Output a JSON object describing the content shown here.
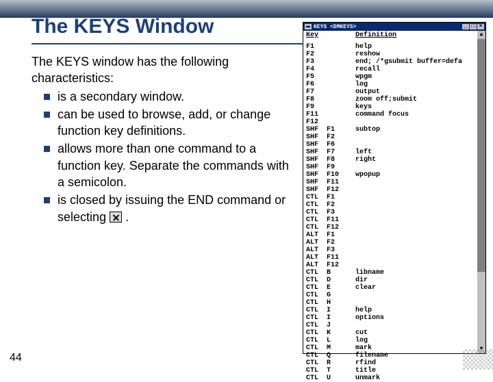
{
  "slide": {
    "title": "The KEYS Window",
    "page_number": "44",
    "intro": "The KEYS window has the following characteristics:",
    "bullets": [
      "is a secondary window.",
      "can be used to browse, add, or change function key definitions.",
      "allows more than one command to a function key. Separate the commands with a semicolon.",
      "is closed by issuing the END command or selecting "
    ],
    "bullet4_suffix": " ."
  },
  "keys_window": {
    "title": "KEYS <DMKEYS>",
    "col_key": "Key",
    "col_def": "Definition",
    "rows": [
      {
        "k1": "F1",
        "k2": "",
        "def": "help"
      },
      {
        "k1": "F2",
        "k2": "",
        "def": "reshow"
      },
      {
        "k1": "F3",
        "k2": "",
        "def": "end; /*gsubmit buffer=defa"
      },
      {
        "k1": "F4",
        "k2": "",
        "def": "recall"
      },
      {
        "k1": "F5",
        "k2": "",
        "def": "wpgm"
      },
      {
        "k1": "F6",
        "k2": "",
        "def": "log"
      },
      {
        "k1": "F7",
        "k2": "",
        "def": "output"
      },
      {
        "k1": "F8",
        "k2": "",
        "def": "zoom off;submit"
      },
      {
        "k1": "F9",
        "k2": "",
        "def": "keys"
      },
      {
        "k1": "F11",
        "k2": "",
        "def": "command focus"
      },
      {
        "k1": "F12",
        "k2": "",
        "def": ""
      },
      {
        "k1": "SHF",
        "k2": "F1",
        "def": "subtop"
      },
      {
        "k1": "SHF",
        "k2": "F2",
        "def": ""
      },
      {
        "k1": "SHF",
        "k2": "F6",
        "def": ""
      },
      {
        "k1": "SHF",
        "k2": "F7",
        "def": "left"
      },
      {
        "k1": "SHF",
        "k2": "F8",
        "def": "right"
      },
      {
        "k1": "SHF",
        "k2": "F9",
        "def": ""
      },
      {
        "k1": "SHF",
        "k2": "F10",
        "def": "wpopup"
      },
      {
        "k1": "SHF",
        "k2": "F11",
        "def": ""
      },
      {
        "k1": "SHF",
        "k2": "F12",
        "def": ""
      },
      {
        "k1": "CTL",
        "k2": "F1",
        "def": ""
      },
      {
        "k1": "CTL",
        "k2": "F2",
        "def": ""
      },
      {
        "k1": "CTL",
        "k2": "F3",
        "def": ""
      },
      {
        "k1": "CTL",
        "k2": "F11",
        "def": ""
      },
      {
        "k1": "CTL",
        "k2": "F12",
        "def": ""
      },
      {
        "k1": "ALT",
        "k2": "F1",
        "def": ""
      },
      {
        "k1": "ALT",
        "k2": "F2",
        "def": ""
      },
      {
        "k1": "ALT",
        "k2": "F3",
        "def": ""
      },
      {
        "k1": "ALT",
        "k2": "F11",
        "def": ""
      },
      {
        "k1": "ALT",
        "k2": "F12",
        "def": ""
      },
      {
        "k1": "CTL",
        "k2": "B",
        "def": "libname"
      },
      {
        "k1": "CTL",
        "k2": "D",
        "def": "dir"
      },
      {
        "k1": "CTL",
        "k2": "E",
        "def": "clear"
      },
      {
        "k1": "CTL",
        "k2": "G",
        "def": ""
      },
      {
        "k1": "CTL",
        "k2": "H",
        "def": ""
      },
      {
        "k1": "CTL",
        "k2": "I",
        "def": "help"
      },
      {
        "k1": "CTL",
        "k2": "I",
        "def": "options"
      },
      {
        "k1": "CTL",
        "k2": "J",
        "def": ""
      },
      {
        "k1": "CTL",
        "k2": "K",
        "def": "cut"
      },
      {
        "k1": "CTL",
        "k2": "L",
        "def": "log"
      },
      {
        "k1": "CTL",
        "k2": "M",
        "def": "mark"
      },
      {
        "k1": "CTL",
        "k2": "Q",
        "def": "filename"
      },
      {
        "k1": "CTL",
        "k2": "R",
        "def": "rfind"
      },
      {
        "k1": "CTL",
        "k2": "T",
        "def": "title"
      },
      {
        "k1": "CTL",
        "k2": "U",
        "def": "unmark"
      }
    ]
  }
}
